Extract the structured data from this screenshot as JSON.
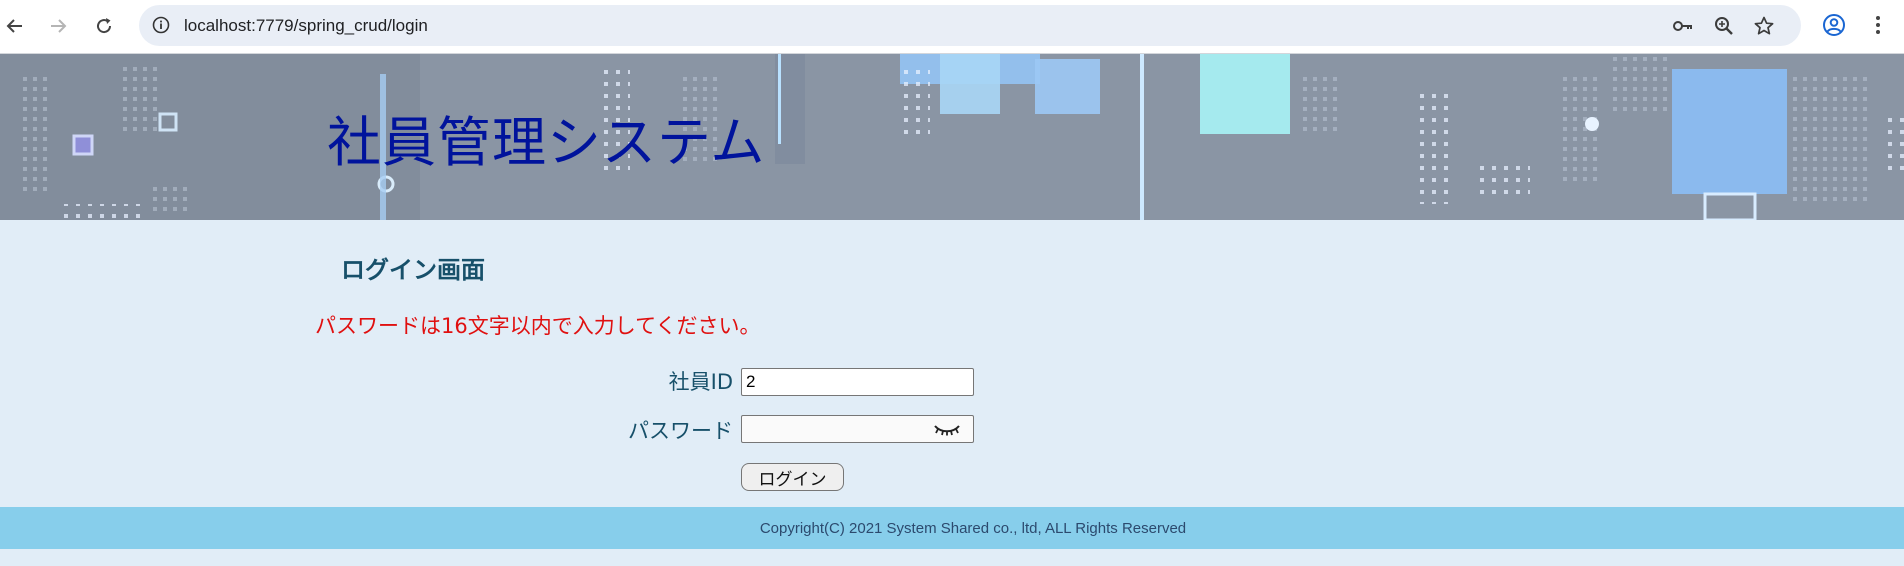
{
  "browser": {
    "url": "localhost:7779/spring_crud/login",
    "back_icon": "arrow-left-icon",
    "forward_icon": "arrow-right-icon",
    "reload_icon": "reload-icon",
    "site_info_icon": "info-icon",
    "password_key_icon": "key-icon",
    "zoom_icon": "zoom-icon",
    "bookmark_icon": "star-icon",
    "profile_icon": "account-icon",
    "menu_icon": "more-vert-icon"
  },
  "header": {
    "title": "社員管理システム"
  },
  "login": {
    "heading": "ログイン画面",
    "error_message": "パスワードは16文字以内で入力してください。",
    "employee_id_label": "社員ID",
    "employee_id_value": "2",
    "password_label": "パスワード",
    "password_value": "",
    "password_toggle_icon": "eye-closed-icon",
    "submit_label": "ログイン"
  },
  "footer": {
    "copyright": "Copyright(C) 2021 System Shared co., ltd, ALL Rights Reserved"
  },
  "colors": {
    "title": "#00139c",
    "heading": "#17506a",
    "error": "#e01010",
    "content_background": "#e1edf7",
    "footer_background": "#87ceeb"
  }
}
